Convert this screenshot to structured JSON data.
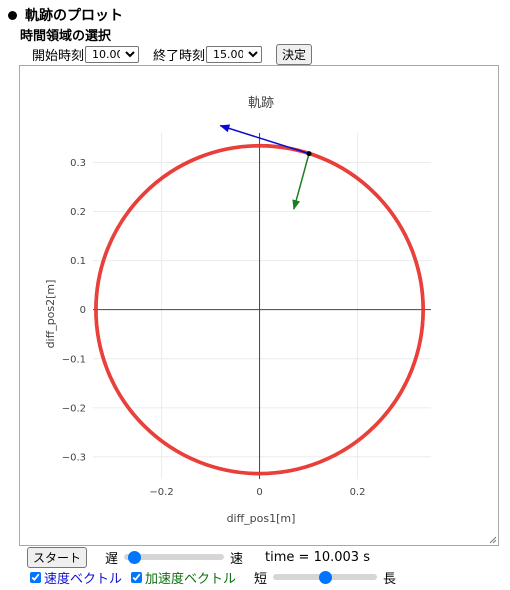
{
  "heading": "軌跡のプロット",
  "subheading": "時間領域の選択",
  "range": {
    "start_label": "開始時刻",
    "start_value": "10.003",
    "end_label": "終了時刻",
    "end_value": "15.003",
    "apply_label": "決定"
  },
  "controls": {
    "start_button": "スタート",
    "slow_label": "遅",
    "fast_label": "速",
    "time_text": "time = 10.003 s",
    "velocity_label": "速度ベクトル",
    "velocity_checked": true,
    "acceleration_label": "加速度ベクトル",
    "acceleration_checked": true,
    "short_label": "短",
    "long_label": "長",
    "speed_level": 0.05,
    "length_level": 0.5
  },
  "colors": {
    "trajectory": "#e8302a",
    "velocity": "#0a0ad8",
    "acceleration": "#1e7e1e",
    "grid": "#ebebeb"
  },
  "chart_data": {
    "type": "scatter",
    "title": "軌跡",
    "xlabel": "diff_pos1[m]",
    "ylabel": "diff_pos2[m]",
    "xlim": [
      -0.34,
      0.35
    ],
    "ylim": [
      -0.345,
      0.36
    ],
    "xticks": [
      -0.2,
      0,
      0.2
    ],
    "xtick_labels": [
      "−0.2",
      "0",
      "0.2"
    ],
    "yticks": [
      -0.3,
      -0.2,
      -0.1,
      0,
      0.1,
      0.2,
      0.3
    ],
    "ytick_labels": [
      "−0.3",
      "−0.2",
      "−0.1",
      "0",
      "0.1",
      "0.2",
      "0.3"
    ],
    "grid": true,
    "trajectory": {
      "shape": "circle",
      "center": [
        0.0,
        0.0
      ],
      "radius": 0.334,
      "color": "#e8302a"
    },
    "current_point": [
      0.101,
      0.318
    ],
    "velocity_vector": {
      "from": [
        0.101,
        0.318
      ],
      "to": [
        -0.08,
        0.375
      ],
      "color": "#0a0ad8"
    },
    "acceleration_vector": {
      "from": [
        0.101,
        0.318
      ],
      "to": [
        0.07,
        0.205
      ],
      "color": "#1e7e1e"
    }
  }
}
